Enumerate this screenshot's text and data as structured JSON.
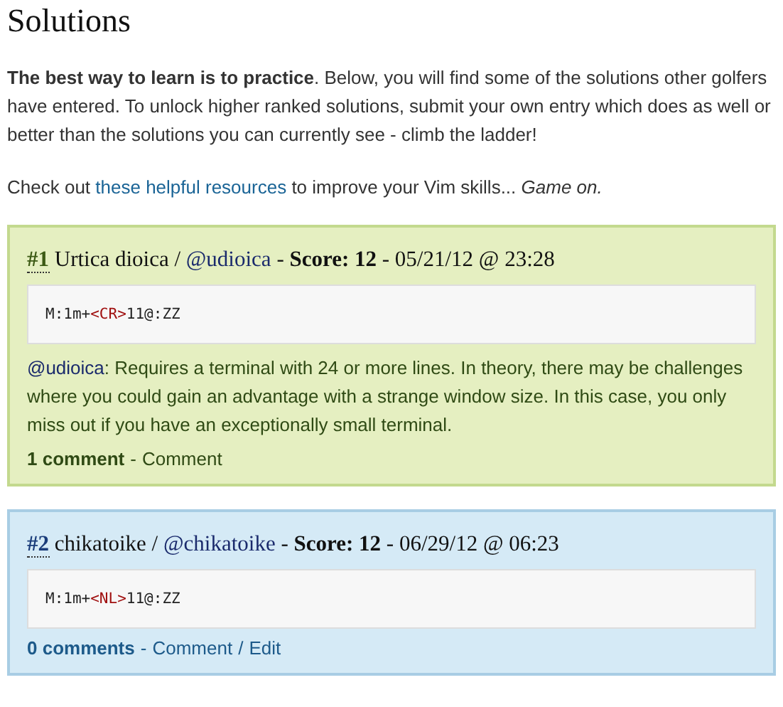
{
  "title": "Solutions",
  "intro": "**The best way to learn is to practice**. Below, you will find some of the solutions other golfers have entered. To unlock higher ranked solutions, submit your own entry which does as well or better than the solutions you can currently see - climb the ladder!",
  "resources": {
    "before": "Check out",
    "link": "these helpful resources",
    "after": "to improve your Vim skills...",
    "tail": "Game on."
  },
  "entries": [
    {
      "kind": "other",
      "rank": "#1",
      "name": "Urtica dioica",
      "slash": "/",
      "handle": "@udioica",
      "dash": "-",
      "score": "Score: 12",
      "dash2": "-",
      "date": "05/21/12 @ 23:28",
      "code": [
        {
          "kind": "plain",
          "text": "M:1m+"
        },
        {
          "kind": "key",
          "text": "<CR>"
        },
        {
          "kind": "plain",
          "text": "11@:ZZ"
        }
      ],
      "note": {
        "handle": "@udioica",
        "text": ": Requires a terminal with 24 or more lines. In theory, there may be challenges where you could gain an advantage with a strange window size. In this case, you only miss out if you have an exceptionally small terminal."
      },
      "comments": "1 comment",
      "comments_sep": "-",
      "actions": [
        "Comment"
      ]
    },
    {
      "kind": "own",
      "rank": "#2",
      "name": "chikatoike",
      "slash": "/",
      "handle": "@chikatoike",
      "dash": "-",
      "score": "Score: 12",
      "dash2": "-",
      "date": "06/29/12 @ 06:23",
      "code": [
        {
          "kind": "plain",
          "text": "M:1m+"
        },
        {
          "kind": "key",
          "text": "<NL>"
        },
        {
          "kind": "plain",
          "text": "11@:ZZ"
        }
      ],
      "comments": "0 comments",
      "comments_sep": "-",
      "actions": [
        "Comment",
        "Edit"
      ],
      "actions_sep": "/"
    }
  ]
}
